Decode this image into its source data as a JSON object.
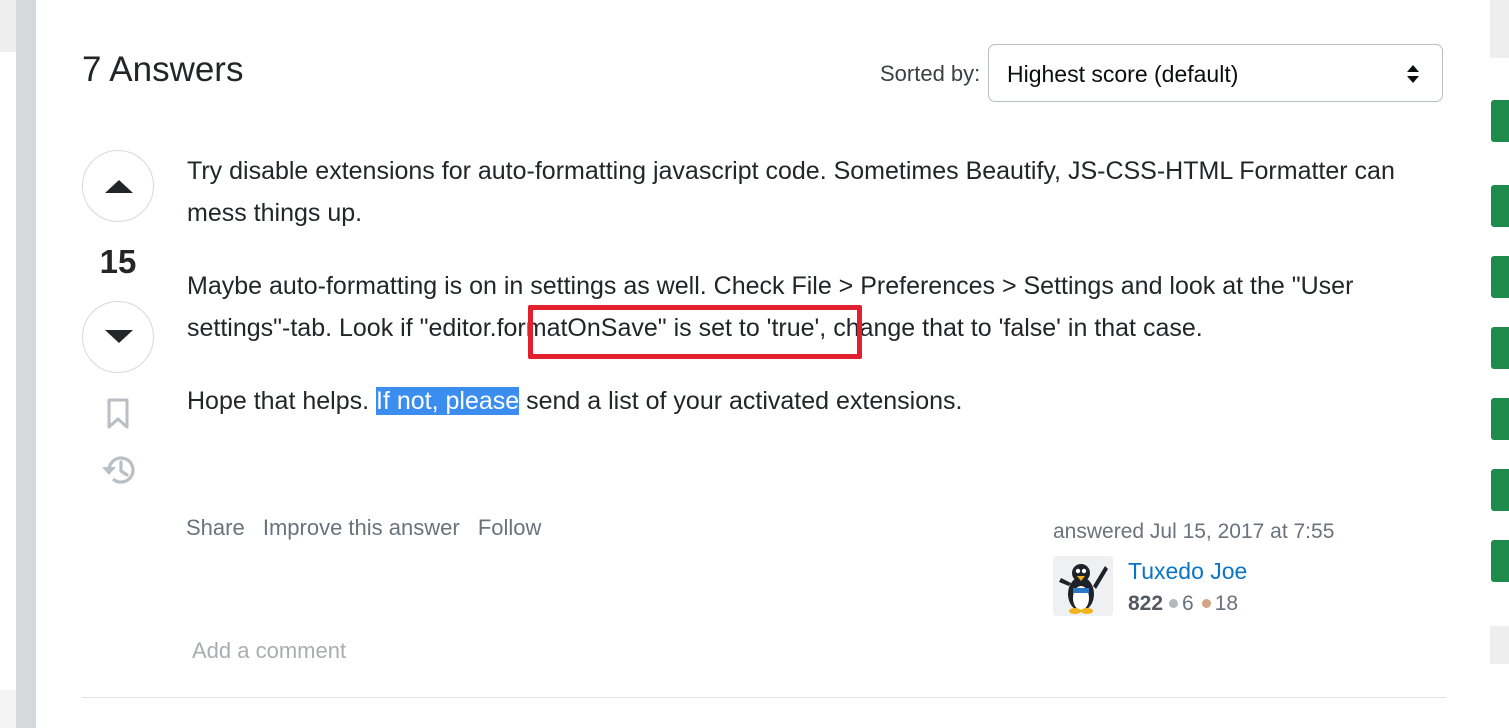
{
  "answers_header": {
    "title": "7 Answers"
  },
  "sort": {
    "label": "Sorted by:",
    "value": "Highest score (default)"
  },
  "vote": {
    "count": "15"
  },
  "post": {
    "p1": "Try disable extensions for auto-formatting javascript code. Sometimes Beautify, JS-CSS-HTML Formatter can mess things up.",
    "p2": "Maybe auto-formatting is on in settings as well. Check File > Preferences > Settings and look at the \"User settings\"-tab. Look if \"editor.formatOnSave\" is set to 'true', change that to 'false' in that case.",
    "p3_before": "Hope that helps. ",
    "p3_selected": "If not, please",
    "p3_after": " send a list of your activated extensions."
  },
  "actions": {
    "share": "Share",
    "improve": "Improve this answer",
    "follow": "Follow"
  },
  "signature": {
    "answered": "answered Jul 15, 2017 at 7:55",
    "user_name": "Tuxedo Joe",
    "reputation": "822",
    "silver_badges": "6",
    "bronze_badges": "18"
  },
  "comment": {
    "add": "Add a comment"
  },
  "colors": {
    "highlight": "#3b8ef0",
    "annotation_box": "#e2202e",
    "link": "#0a74c6",
    "accent_green": "#1e8a4c"
  },
  "icons": [
    "arrow-up-icon",
    "arrow-down-icon",
    "bookmark-icon",
    "history-icon",
    "sort-arrows-icon",
    "penguin-avatar"
  ]
}
